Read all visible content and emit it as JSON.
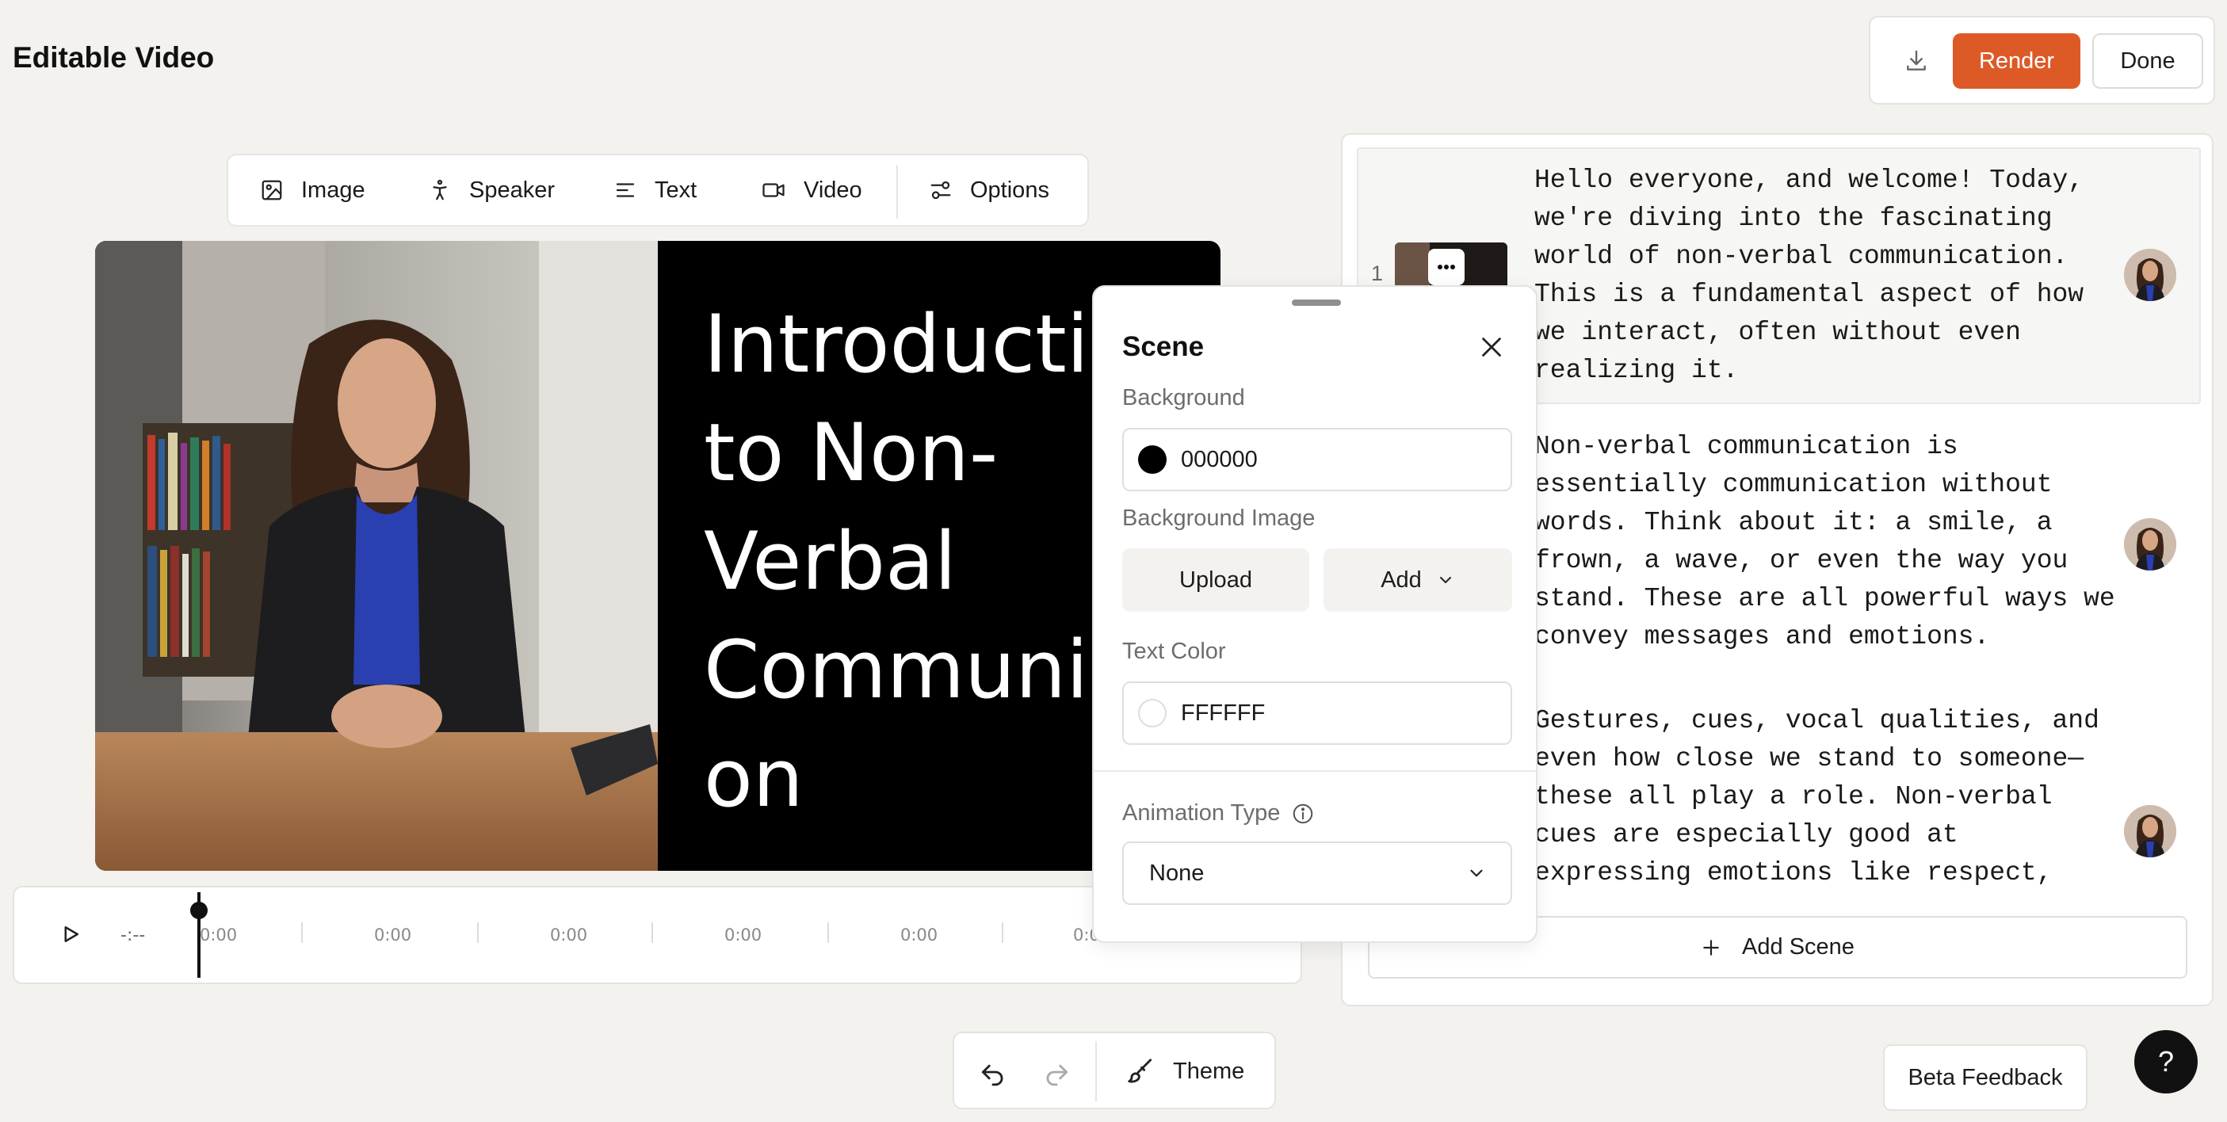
{
  "app": {
    "title": "Editable Video"
  },
  "topbar": {
    "render_label": "Render",
    "done_label": "Done",
    "download_icon": "download-icon"
  },
  "media_toolbar": {
    "items": [
      {
        "label": "Image",
        "icon": "image-icon"
      },
      {
        "label": "Speaker",
        "icon": "speaker-icon"
      },
      {
        "label": "Text",
        "icon": "text-icon"
      },
      {
        "label": "Video",
        "icon": "video-icon"
      },
      {
        "label": "Options",
        "icon": "options-icon"
      }
    ]
  },
  "preview": {
    "slide_title": "Introductio\nto Non-\nVerbal\nCommunica\non"
  },
  "timeline": {
    "time_display": "-:--",
    "ticks": [
      "0:00",
      "0:00",
      "0:00",
      "0:00",
      "0:00",
      "0:0"
    ]
  },
  "scene_panel": {
    "title": "Scene",
    "background_label": "Background",
    "background_value": "000000",
    "background_color": "#000000",
    "background_image_label": "Background Image",
    "upload_label": "Upload",
    "add_label": "Add",
    "text_color_label": "Text Color",
    "text_color_value": "FFFFFF",
    "text_color": "#FFFFFF",
    "animation_type_label": "Animation Type",
    "animation_type_value": "None"
  },
  "script": {
    "scene_number": "1",
    "paragraphs": [
      "Hello everyone, and welcome! Today,\nwe're diving into the fascinating\nworld of non-verbal communication.\nThis is a fundamental aspect of how\nwe interact, often without even\nrealizing it.",
      "Non-verbal communication is\nessentially communication without\nwords. Think about it: a smile, a\nfrown, a wave, or even the way you\nstand. These are all powerful ways we\nconvey messages and emotions.",
      "Gestures, cues, vocal qualities, and\neven how close we stand to someone—\nthese all play a role. Non-verbal\ncues are especially good at\nexpressing emotions like respect,"
    ],
    "add_scene_label": "Add Scene"
  },
  "bottom_toolbar": {
    "theme_label": "Theme"
  },
  "beta_feedback_label": "Beta Feedback",
  "help_label": "?",
  "colors": {
    "accent": "#dd5a26",
    "background": "#f3f2ef"
  }
}
